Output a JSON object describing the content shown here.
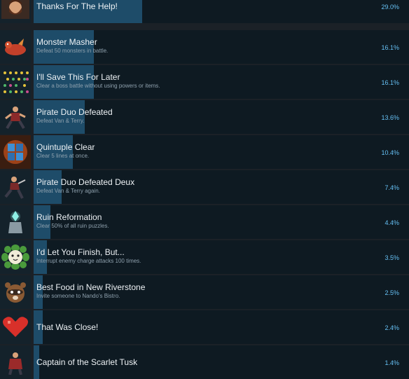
{
  "achievements": [
    {
      "title": "Thanks For The Help!",
      "description": "",
      "percent_text": "29.0%",
      "fill": 0.29,
      "icon": "bearded-man-icon"
    },
    {
      "title": "Monster Masher",
      "description": "Defeat 50 monsters in battle.",
      "percent_text": "16.1%",
      "fill": 0.161,
      "icon": "red-dragon-icon"
    },
    {
      "title": "I'll Save This For Later",
      "description": "Clear a boss battle without using powers or items.",
      "percent_text": "16.1%",
      "fill": 0.161,
      "icon": "gems-grid-icon"
    },
    {
      "title": "Pirate Duo Defeated",
      "description": "Defeat Van & Terry.",
      "percent_text": "13.6%",
      "fill": 0.136,
      "icon": "pirate-fighter-icon"
    },
    {
      "title": "Quintuple Clear",
      "description": "Clear 5 lines at once.",
      "percent_text": "10.4%",
      "fill": 0.104,
      "icon": "fiery-block-icon"
    },
    {
      "title": "Pirate Duo Defeated Deux",
      "description": "Defeat Van & Terry again.",
      "percent_text": "7.4%",
      "fill": 0.074,
      "icon": "pirate-runner-icon"
    },
    {
      "title": "Ruin Reformation",
      "description": "Clear 50% of all ruin puzzles.",
      "percent_text": "4.4%",
      "fill": 0.044,
      "icon": "ruin-crystal-icon"
    },
    {
      "title": "I'd Let You Finish, But...",
      "description": "Interrupt enemy charge attacks 100 times.",
      "percent_text": "3.5%",
      "fill": 0.035,
      "icon": "flower-creature-icon"
    },
    {
      "title": "Best Food in New Riverstone",
      "description": "Invite someone to Nando's Bistro.",
      "percent_text": "2.5%",
      "fill": 0.025,
      "icon": "raccoon-chef-icon"
    },
    {
      "title": "That Was Close!",
      "description": "",
      "percent_text": "2.4%",
      "fill": 0.024,
      "icon": "red-heart-icon"
    },
    {
      "title": "Captain of the Scarlet Tusk",
      "description": "",
      "percent_text": "1.4%",
      "fill": 0.014,
      "icon": "pirate-captain-icon"
    }
  ]
}
